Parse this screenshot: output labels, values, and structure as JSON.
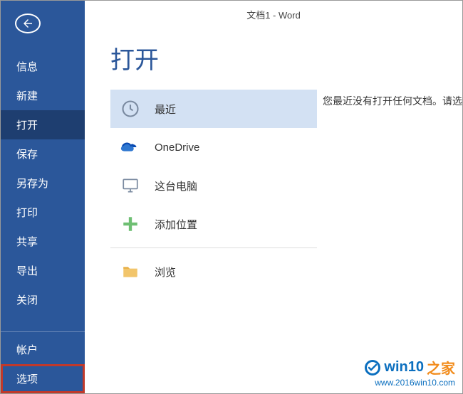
{
  "doc_title": "文档1 - Word",
  "page_title": "打开",
  "sidebar": {
    "items": [
      {
        "label": "信息"
      },
      {
        "label": "新建"
      },
      {
        "label": "打开"
      },
      {
        "label": "保存"
      },
      {
        "label": "另存为"
      },
      {
        "label": "打印"
      },
      {
        "label": "共享"
      },
      {
        "label": "导出"
      },
      {
        "label": "关闭"
      },
      {
        "label": "帐户"
      },
      {
        "label": "选项"
      }
    ]
  },
  "locations": {
    "recent": "最近",
    "onedrive": "OneDrive",
    "thispc": "这台电脑",
    "addplace": "添加位置",
    "browse": "浏览"
  },
  "right_message": "您最近没有打开任何文档。请选",
  "watermark": {
    "brand1": "win10",
    "brand2": "之家",
    "url": "www.2016win10.com"
  }
}
